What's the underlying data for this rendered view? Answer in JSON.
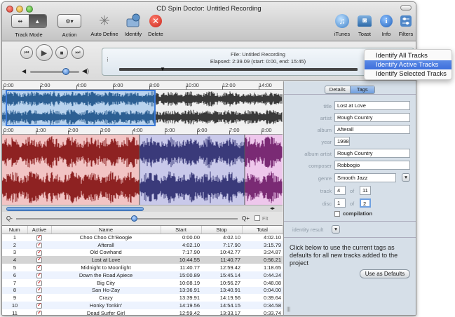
{
  "window": {
    "title": "CD Spin Doctor: Untitled Recording"
  },
  "toolbar": {
    "track_mode": "Track Mode",
    "action": "Action",
    "auto_define": "Auto Define",
    "identify": "Identify",
    "delete": "Delete",
    "itunes": "iTunes",
    "toast": "Toast",
    "info": "Info",
    "filters": "Filters"
  },
  "display": {
    "file": "File: Untitled Recording",
    "elapsed": "Elapsed: 2:39.09 (start: 0:00, end: 15:45)"
  },
  "identify_menu": {
    "items": [
      "Identify All Tracks",
      "Identify Active Tracks",
      "Identify Selected Tracks"
    ],
    "selected": "Identify Active Tracks"
  },
  "overview_ruler": [
    "0:00",
    "2:00",
    "4:00",
    "6:00",
    "8:00",
    "10:00",
    "12:00",
    "14:00"
  ],
  "detail_ruler": [
    "0:00",
    "1:00",
    "2:00",
    "3:00",
    "4:00",
    "5:00",
    "6:00",
    "7:00",
    "8:00"
  ],
  "zoom": {
    "fit_label": "Fit"
  },
  "table": {
    "headers": [
      "Num",
      "Active",
      "Name",
      "Start",
      "Stop",
      "Total"
    ],
    "rows": [
      [
        "1",
        "Choo Choo Ch'Boogie",
        "0:00.00",
        "4:02.10",
        "4:02.10"
      ],
      [
        "2",
        "Afterall",
        "4:02.10",
        "7:17.90",
        "3:15.79"
      ],
      [
        "3",
        "Old Cowhand",
        "7:17.90",
        "10:42.77",
        "3:24.87"
      ],
      [
        "4",
        "Lost at Love",
        "10:44.55",
        "11:40.77",
        "0:56.21"
      ],
      [
        "5",
        "Midnight to Moonlight",
        "11:40.77",
        "12:59.42",
        "1:18.65"
      ],
      [
        "6",
        "Down the Road Apiece",
        "15:00.89",
        "15:45.14",
        "0:44.24"
      ],
      [
        "7",
        "Big City",
        "10:08.19",
        "10:56.27",
        "0:48.08"
      ],
      [
        "8",
        "San Ho-Zay",
        "13:36.91",
        "13:40.91",
        "0:04.00"
      ],
      [
        "9",
        "Crazy",
        "13:39.91",
        "14:19.56",
        "0:39.64"
      ],
      [
        "10",
        "Honky Tonkin'",
        "14:19.56",
        "14:54.15",
        "0:34.58"
      ],
      [
        "11",
        "Dead Surfer Girl",
        "12:59.42",
        "13:33.17",
        "0:33.74"
      ]
    ]
  },
  "tabs": {
    "details": "Details",
    "tags": "Tags"
  },
  "tags": {
    "title_label": "title",
    "title": "Lost at Love",
    "artist_label": "artist",
    "artist": "Rough Country",
    "album_label": "album",
    "album": "Afterall",
    "year_label": "year",
    "year": "1998",
    "album_artist_label": "album artist",
    "album_artist": "Rough Country",
    "composer_label": "composer",
    "composer": "Robbogio",
    "genre_label": "genre",
    "genre": "Smooth Jazz",
    "track_label": "track",
    "track": "4",
    "track_of_label": "of",
    "track_of": "11",
    "disc_label": "disc",
    "disc": "1",
    "disc_of_label": "of",
    "disc_of": "2",
    "compilation_label": "compilation",
    "identity_label": "identity result"
  },
  "defaults": {
    "text": "Click below to use the current tags as defaults for all new tracks added to the project",
    "button": "Use as Defaults"
  }
}
